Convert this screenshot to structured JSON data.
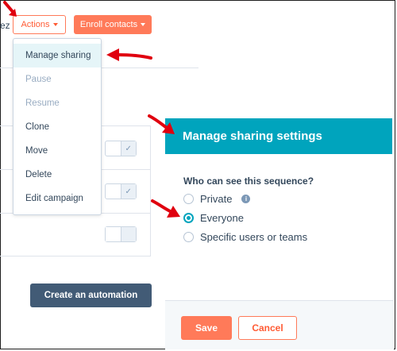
{
  "toolbar": {
    "clipped_text": "ez",
    "actions_label": "Actions",
    "enroll_label": "Enroll contacts"
  },
  "actions_menu": {
    "items": [
      {
        "label": "Manage sharing",
        "state": "highlighted"
      },
      {
        "label": "Pause",
        "state": "disabled"
      },
      {
        "label": "Resume",
        "state": "disabled"
      },
      {
        "label": "Clone",
        "state": "enabled"
      },
      {
        "label": "Move",
        "state": "enabled"
      },
      {
        "label": "Delete",
        "state": "enabled"
      },
      {
        "label": "Edit campaign",
        "state": "enabled"
      }
    ]
  },
  "rows": {
    "toggles": [
      {
        "state": "on"
      },
      {
        "state": "on"
      },
      {
        "state": "off"
      }
    ]
  },
  "automation_button_label": "Create an automation",
  "sharing_panel": {
    "title": "Manage sharing settings",
    "question": "Who can see this sequence?",
    "options": [
      {
        "label": "Private",
        "checked": false,
        "has_info_icon": true
      },
      {
        "label": "Everyone",
        "checked": true
      },
      {
        "label": "Specific users or teams",
        "checked": false
      }
    ],
    "save_label": "Save",
    "cancel_label": "Cancel"
  },
  "colors": {
    "accent_orange": "#ff7a59",
    "header_teal": "#00a4bd",
    "dark_button": "#425b76",
    "annotation_red": "#e0000f"
  },
  "icons": {
    "caret": "chevron-down-icon",
    "check": "check-icon",
    "info": "info-icon",
    "annotation": "red-arrow-icon"
  }
}
